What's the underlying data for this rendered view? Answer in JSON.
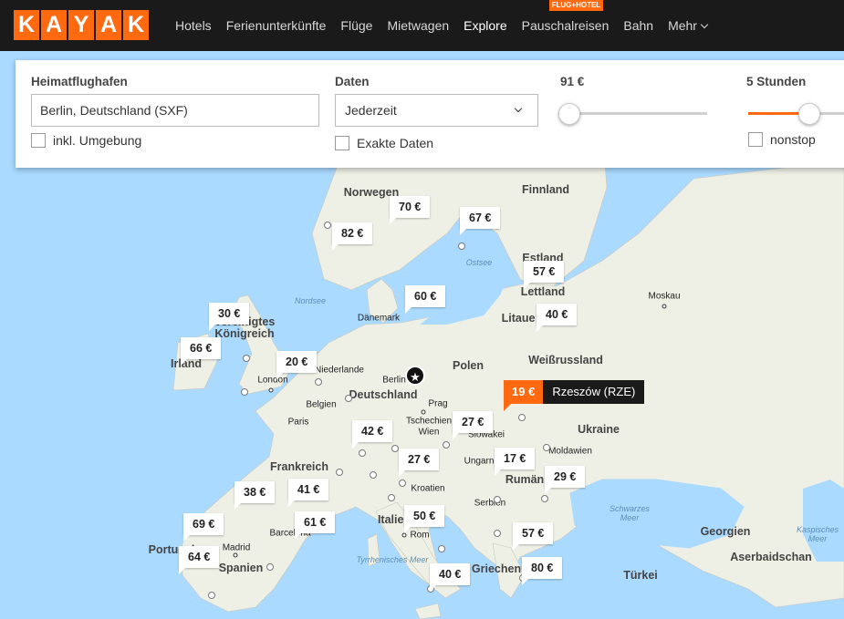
{
  "brand": {
    "logo_letters": [
      "K",
      "A",
      "Y",
      "A",
      "K"
    ],
    "accent_color": "#ff690f"
  },
  "nav": {
    "items": [
      {
        "label": "Hotels"
      },
      {
        "label": "Ferienunterkünfte"
      },
      {
        "label": "Flüge"
      },
      {
        "label": "Mietwagen"
      },
      {
        "label": "Explore",
        "active": true
      },
      {
        "label": "Pauschalreisen",
        "badge": "FLUG+HOTEL"
      },
      {
        "label": "Bahn"
      },
      {
        "label": "Mehr",
        "dropdown": true
      }
    ]
  },
  "search": {
    "origin_label": "Heimatflughafen",
    "origin_value": "Berlin, Deutschland (SXF)",
    "nearby_label": "inkl. Umgebung",
    "dates_label": "Daten",
    "dates_value": "Jederzeit",
    "exact_dates_label": "Exakte Daten",
    "price_label": "91 €",
    "price_slider_fraction": 0.0,
    "duration_label": "5 Stunden",
    "duration_slider_fraction": 0.38,
    "nonstop_label": "nonstop"
  },
  "map": {
    "countries": [
      "Norwegen",
      "Finnland",
      "Estland",
      "Lettland",
      "Litaue",
      "Dänemark",
      "Vereinigtes Königreich",
      "Irland",
      "Niederlande",
      "Polen",
      "Weißrussland",
      "Belgien",
      "Deutschland",
      "Tschechien",
      "Slowakei",
      "Ukraine",
      "Moldawien",
      "Frankreich",
      "Ungarn",
      "Rumän",
      "Kroatien",
      "Serbien",
      "Italien",
      "Georgien",
      "Portugal",
      "Spanien",
      "Griechen",
      "Türkei",
      "Aserbaidschan"
    ],
    "cities": [
      "Moskau",
      "London",
      "Berlin",
      "Prag",
      "Wien",
      "Paris",
      "Rom",
      "Madrid",
      "Barcelona"
    ],
    "seas": [
      "Nordsee",
      "Ostsee",
      "Schwarzes Meer",
      "Tyrrhenisches Meer",
      "Kaspisches Meer"
    ],
    "home_icon": "star-icon",
    "prices": [
      "70 €",
      "67 €",
      "82 €",
      "57 €",
      "60 €",
      "40 €",
      "30 €",
      "66 €",
      "20 €",
      "42 €",
      "27 €",
      "27 €",
      "17 €",
      "29 €",
      "38 €",
      "41 €",
      "69 €",
      "61 €",
      "50 €",
      "64 €",
      "57 €",
      "80 €",
      "40 €"
    ],
    "highlight": {
      "price": "19 €",
      "destination": "Rzeszów (RZE)"
    }
  }
}
